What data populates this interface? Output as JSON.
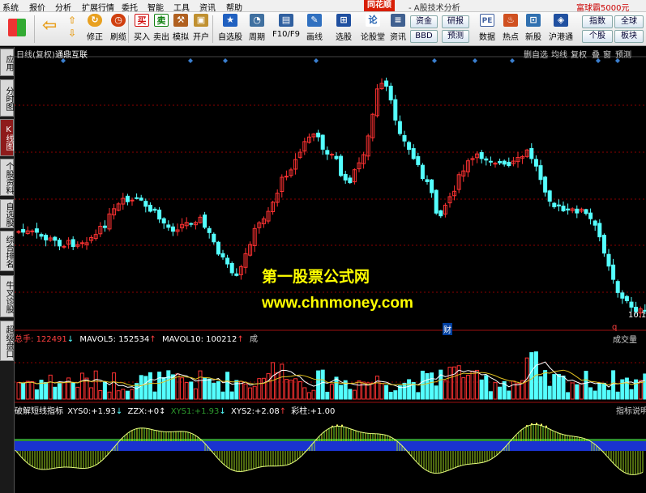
{
  "menu": {
    "items": [
      "系统",
      "报价",
      "分析",
      "扩展行情",
      "委托",
      "智能",
      "工具",
      "资讯",
      "帮助"
    ],
    "brand": "同花顺",
    "tagline": "- A股技术分析",
    "promo": "富球霸5000元"
  },
  "toolbar": {
    "buttons": [
      {
        "label": "修正",
        "icon": "refresh-icon",
        "color": "#e8a020"
      },
      {
        "label": "刷缆",
        "icon": "clock-icon",
        "color": "#d04010"
      },
      {
        "label": "买入",
        "glyph": "买",
        "icon": "buy-icon",
        "color": "#d01010"
      },
      {
        "label": "卖出",
        "glyph": "卖",
        "icon": "sell-icon",
        "color": "#108010"
      },
      {
        "label": "模拟",
        "icon": "hammer-icon",
        "color": "#b06020"
      },
      {
        "label": "开户",
        "icon": "lock-icon",
        "color": "#c09030"
      },
      {
        "label": "自选股",
        "icon": "star-icon",
        "color": "#2060c0"
      },
      {
        "label": "周期",
        "icon": "period-icon",
        "color": "#4070a0"
      },
      {
        "label": "F10/F9",
        "icon": "f10-icon",
        "color": "#3060a0"
      },
      {
        "label": "画线",
        "icon": "pen-icon",
        "color": "#3070c0"
      },
      {
        "label": "选股",
        "icon": "select-icon",
        "color": "#2050a0"
      },
      {
        "label": "论股堂",
        "glyph": "论",
        "icon": "forum-icon",
        "color": "#2060b0"
      },
      {
        "label": "资讯",
        "icon": "news-icon",
        "color": "#406090"
      },
      {
        "label": "数据",
        "glyph": "PE",
        "icon": "pe-icon",
        "color": "#4060a0"
      },
      {
        "label": "热点",
        "icon": "hot-icon",
        "color": "#d05020"
      },
      {
        "label": "新股",
        "icon": "new-stock-icon",
        "color": "#3070b0"
      },
      {
        "label": "沪港通",
        "icon": "hk-icon",
        "color": "#2050a0"
      }
    ],
    "small": {
      "zijin": "资金",
      "bbd": "BBD",
      "yanbao": "研报",
      "yuce": "预测",
      "zhishu": "指数",
      "quanqiu": "全球",
      "gegu": "个股",
      "bankuai": "板块"
    }
  },
  "sidebar": {
    "tabs": [
      "应用",
      "分时图",
      "K线图",
      "个股资料",
      "自选股",
      "综合排名",
      "牛叉诊股",
      "超级盘口"
    ]
  },
  "kline": {
    "header_left": "日线(复权)",
    "stock_name": "通鼎互联",
    "header_right": [
      "删自选",
      "均线",
      "复权",
      "叠",
      "窗",
      "预测"
    ],
    "price_label": "10.1",
    "marker_cai": "财",
    "marker_q": "q"
  },
  "volume": {
    "label_total": "总手:",
    "total_value": "122491",
    "label_ma5": "MAVOL5:",
    "ma5_value": "152534",
    "label_ma10": "MAVOL10:",
    "ma10_value": "100212",
    "suffix": "成",
    "right_label": "成交量"
  },
  "indicator": {
    "name": "破解短线指标",
    "xys0_label": "XYS0:",
    "xys0_value": "+1.93",
    "zzx_label": "ZZX:",
    "zzx_value": "+0",
    "xys1_label": "XYS1:",
    "xys1_value": "+1.93",
    "xys2_label": "XYS2:",
    "xys2_value": "+2.08",
    "caizhu_label": "彩柱:",
    "caizhu_value": "+1.00",
    "right_label": "指标说明"
  },
  "watermark": {
    "line1": "第一股票公式网",
    "line2": "www.chnmoney.com"
  },
  "colors": {
    "up": "#ff3232",
    "down": "#54ffff",
    "background": "#000000",
    "watermark": "#ffff00",
    "grid": "#8b0000"
  }
}
